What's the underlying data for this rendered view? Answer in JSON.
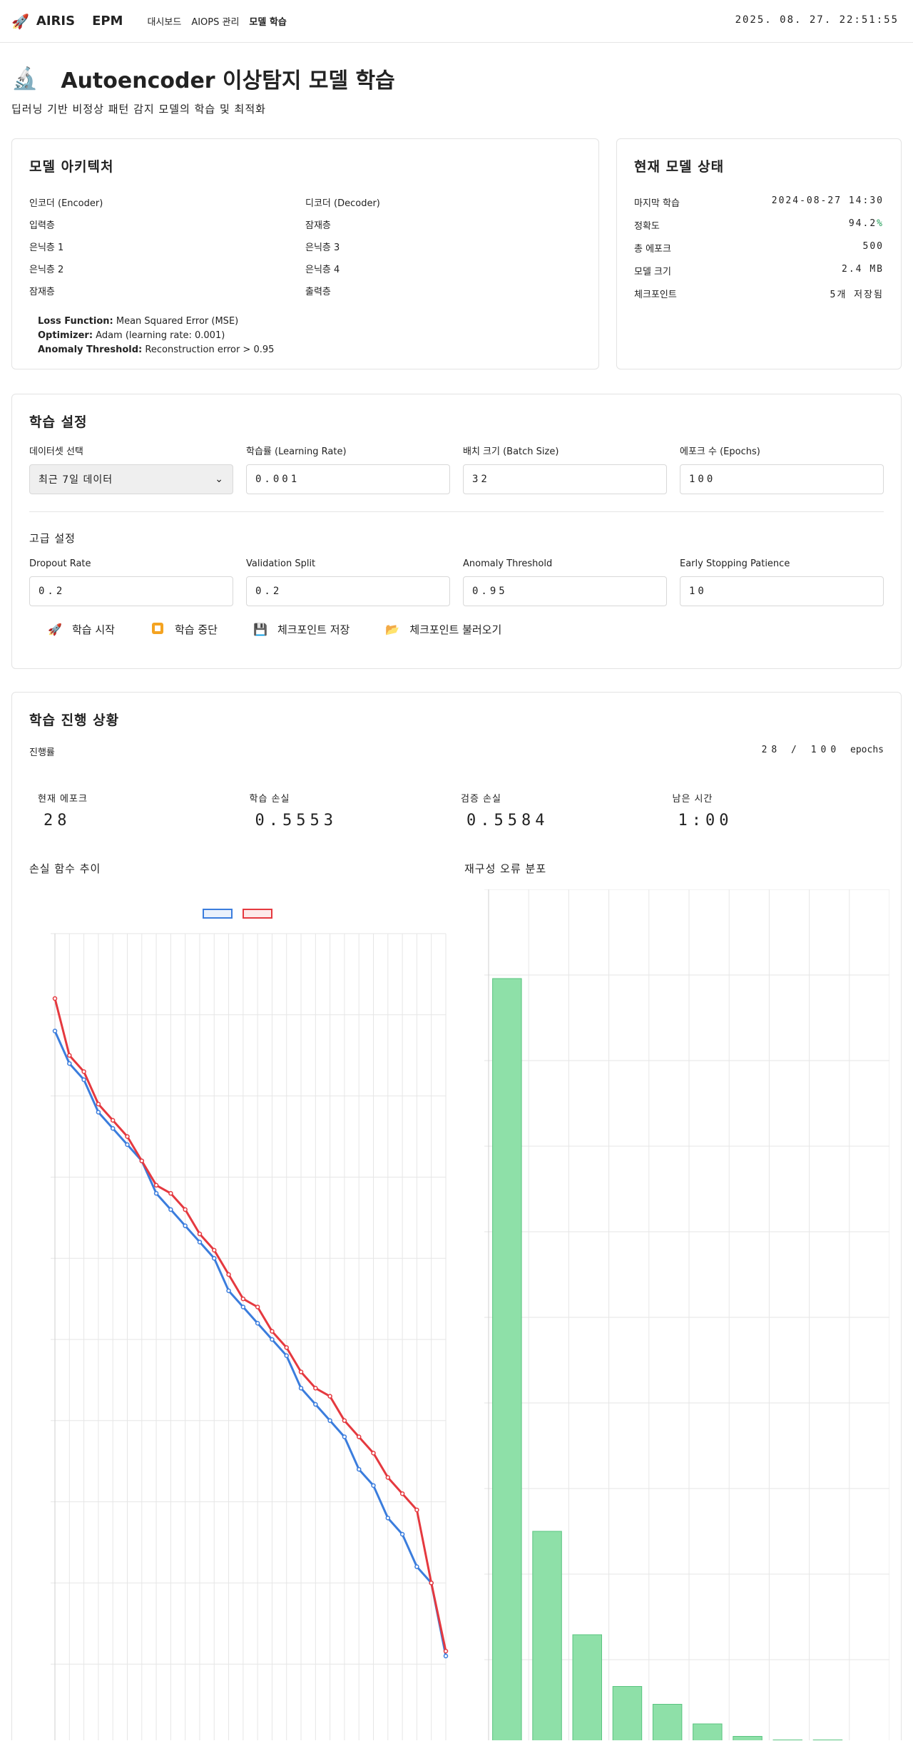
{
  "header": {
    "brand_a": "AIRIS",
    "brand_b": "EPM",
    "nav": [
      "대시보드",
      "AIOPS 관리",
      "모델 학습"
    ],
    "clock": "2025. 08. 27. 22:51:55"
  },
  "page": {
    "title": "Autoencoder 이상탐지 모델 학습",
    "subtitle": "딥러닝 기반 비정상 패턴 감지 모델의 학습 및 최적화"
  },
  "architecture": {
    "title": "모델 아키텍처",
    "encoder_head": "인코더 (Encoder)",
    "decoder_head": "디코더 (Decoder)",
    "encoder_layers": [
      "입력층",
      "은닉층 1",
      "은닉층 2",
      "잠재층"
    ],
    "decoder_layers": [
      "잠재층",
      "은닉층 3",
      "은닉층 4",
      "출력층"
    ],
    "loss_label": "Loss Function:",
    "loss_value": "Mean Squared Error (MSE)",
    "optimizer_label": "Optimizer:",
    "optimizer_value": "Adam (learning rate: 0.001)",
    "threshold_label": "Anomaly Threshold:",
    "threshold_value": "Reconstruction error > 0.95"
  },
  "status": {
    "title": "현재 모델 상태",
    "rows": [
      {
        "label": "마지막 학습",
        "value": "2024-08-27 14:30"
      },
      {
        "label": "정확도",
        "value": "94.2",
        "suffix": "%"
      },
      {
        "label": "총 에포크",
        "value": "500"
      },
      {
        "label": "모델 크기",
        "value": "2.4 MB"
      },
      {
        "label": "체크포인트",
        "value": "5개 저장됨"
      }
    ]
  },
  "training": {
    "title": "학습 설정",
    "dataset_label": "데이터셋 선택",
    "dataset_value": "최근 7일 데이터",
    "lr_label": "학습률 (Learning Rate)",
    "lr_value": "0.001",
    "batch_label": "배치 크기 (Batch Size)",
    "batch_value": "32",
    "epochs_label": "에포크 수 (Epochs)",
    "epochs_value": "100",
    "advanced_title": "고급 설정",
    "dropout_label": "Dropout Rate",
    "dropout_value": "0.2",
    "split_label": "Validation Split",
    "split_value": "0.2",
    "threshold_label": "Anomaly Threshold",
    "threshold_value": "0.95",
    "patience_label": "Early Stopping Patience",
    "patience_value": "10",
    "buttons": {
      "start": "학습 시작",
      "stop": "학습 중단",
      "save": "체크포인트 저장",
      "load": "체크포인트 불러오기"
    }
  },
  "progress": {
    "title": "학습 진행 상황",
    "label": "진행률",
    "value": "28 / 100",
    "unit": "epochs",
    "fraction": 0.28,
    "metrics": [
      {
        "label": "현재 에포크",
        "value": "28"
      },
      {
        "label": "학습 손실",
        "value": "0.5553"
      },
      {
        "label": "검증 손실",
        "value": "0.5584"
      },
      {
        "label": "남은 시간",
        "value": "1:00"
      }
    ],
    "loss_chart_title": "손실 함수 추이",
    "hist_chart_title": "재구성 오류 분포"
  },
  "colors": {
    "train": "#3b7ddd",
    "val": "#e5393f",
    "hist": "#8ee0a8",
    "hist_stroke": "#59c47f",
    "accent_green": "#1e9e57"
  },
  "chart_data": [
    {
      "type": "line",
      "title": "손실 함수 추이",
      "x": [
        1,
        2,
        3,
        4,
        5,
        6,
        7,
        8,
        9,
        10,
        11,
        12,
        13,
        14,
        15,
        16,
        17,
        18,
        19,
        20,
        21,
        22,
        23,
        24,
        25,
        26,
        27,
        28
      ],
      "series": [
        {
          "values": [
            0.94,
            0.92,
            0.91,
            0.89,
            0.88,
            0.87,
            0.86,
            0.84,
            0.83,
            0.82,
            0.81,
            0.8,
            0.78,
            0.77,
            0.76,
            0.75,
            0.74,
            0.72,
            0.71,
            0.7,
            0.69,
            0.67,
            0.66,
            0.64,
            0.63,
            0.61,
            0.6,
            0.555
          ]
        },
        {
          "values": [
            0.96,
            0.925,
            0.915,
            0.895,
            0.885,
            0.875,
            0.86,
            0.845,
            0.84,
            0.83,
            0.815,
            0.805,
            0.79,
            0.775,
            0.77,
            0.755,
            0.745,
            0.73,
            0.72,
            0.715,
            0.7,
            0.69,
            0.68,
            0.665,
            0.655,
            0.645,
            0.6,
            0.558
          ]
        }
      ]
    },
    {
      "type": "bar",
      "title": "재구성 오류 분포",
      "categories": [
        "1",
        "2",
        "3",
        "4",
        "5",
        "6",
        "7",
        "8",
        "9",
        "10"
      ],
      "values": [
        430,
        120,
        62,
        33,
        23,
        12,
        5,
        3,
        3,
        1
      ],
      "ylim": [
        0,
        480
      ]
    }
  ]
}
